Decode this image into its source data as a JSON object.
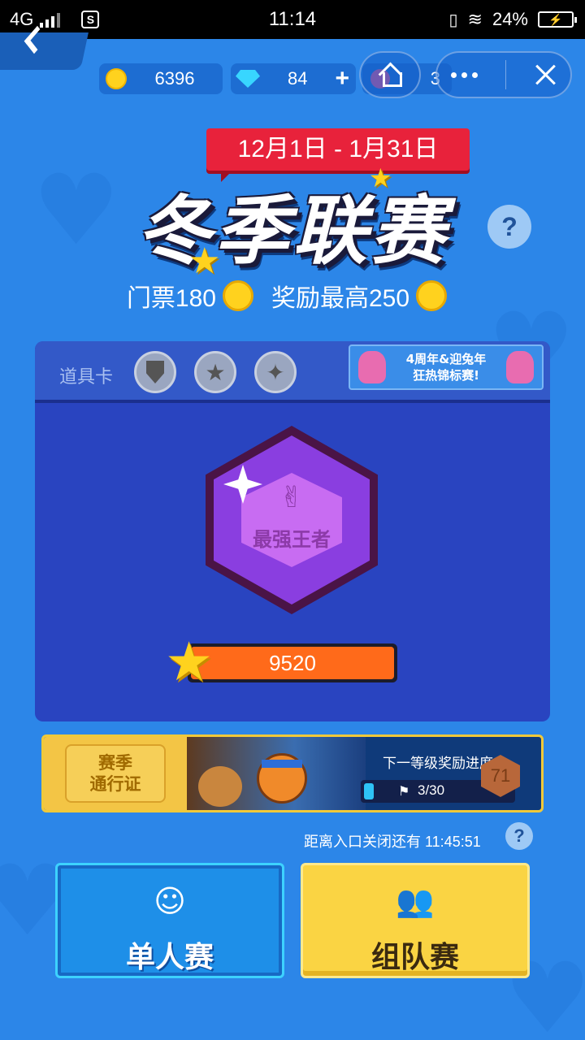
{
  "status_bar": {
    "network": "4G",
    "time": "11:14",
    "battery": "24%"
  },
  "currencies": {
    "coins": "6396",
    "gems": "84",
    "gems_add": "+",
    "tickets": "3"
  },
  "event": {
    "date_range": "12月1日 - 1月31日",
    "title": "冬季联赛",
    "help": "?",
    "ticket_label": "门票180",
    "reward_label": "奖励最高250"
  },
  "panel": {
    "props_label": "道具卡",
    "promo_text_line1": "4周年&迎兔年",
    "promo_text_line2": "狂热锦标赛!",
    "rank_name": "最强王者",
    "score": "9520"
  },
  "pass": {
    "title_line1": "赛季",
    "title_line2": "通行证",
    "progress_label": "下一等级奖励进度",
    "progress_text": "3/30",
    "progress_fraction": 0.1,
    "level": "71"
  },
  "close_timer": "距离入口关闭还有 11:45:51",
  "modes": {
    "single": "单人赛",
    "team": "组队赛"
  },
  "colors": {
    "background": "#2c86e8",
    "panel": "#2944c0",
    "date_banner": "#e8223b",
    "score_fill": "#ff6a1a",
    "team_button": "#fad443",
    "single_button": "#1e8fe8"
  }
}
